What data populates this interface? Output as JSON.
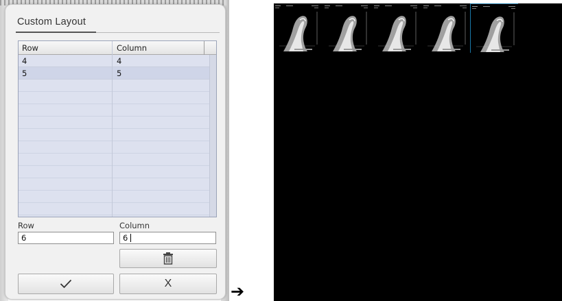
{
  "dialog": {
    "title": "Custom Layout",
    "grid": {
      "headers": [
        "Row",
        "Column"
      ],
      "rows": [
        {
          "row": "4",
          "column": "4"
        },
        {
          "row": "5",
          "column": "5"
        }
      ]
    },
    "row_label": "Row",
    "column_label": "Column",
    "row_value": "6",
    "column_value": "6",
    "confirm_icon": "checkmark-icon",
    "delete_icon": "trash-icon",
    "cancel_label": "X"
  },
  "arrow_icon": "arrow-right-icon",
  "viewer": {
    "background": "#000000",
    "selected_border": "#1a79a8",
    "thumbnail_count": 5,
    "selected_index": 4
  }
}
